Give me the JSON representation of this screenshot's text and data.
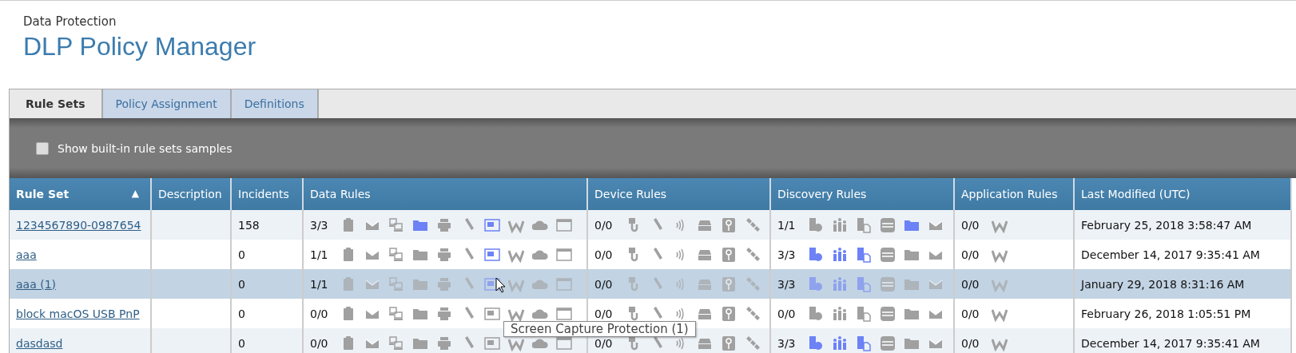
{
  "header": {
    "subtitle": "Data Protection",
    "title": "DLP Policy Manager"
  },
  "tabs": [
    {
      "label": "Rule Sets",
      "selected": true
    },
    {
      "label": "Policy Assignment",
      "selected": false
    },
    {
      "label": "Definitions",
      "selected": false
    }
  ],
  "toolbar": {
    "checkbox_label": "Show built-in rule sets samples",
    "checked": false
  },
  "table": {
    "columns": [
      {
        "label": "Rule Set",
        "sort": "▲"
      },
      {
        "label": "Description"
      },
      {
        "label": "Incidents"
      },
      {
        "label": "Data Rules"
      },
      {
        "label": "Device Rules"
      },
      {
        "label": "Discovery Rules"
      },
      {
        "label": "Application Rules"
      },
      {
        "label": "Last Modified (UTC)"
      }
    ],
    "rows": [
      {
        "name": "1234567890-0987654",
        "description": "",
        "incidents": "158",
        "selected": false,
        "data_rules": {
          "count": "3/3",
          "icons": [
            {
              "on": false
            },
            {
              "on": false
            },
            {
              "on": false
            },
            {
              "on": true
            },
            {
              "on": false
            },
            {
              "on": false
            },
            {
              "on": true
            },
            {
              "on": false
            },
            {
              "on": false
            },
            {
              "on": false
            }
          ]
        },
        "device_rules": {
          "count": "0/0",
          "icons": [
            {
              "on": false
            },
            {
              "on": false
            },
            {
              "on": false
            },
            {
              "on": false
            },
            {
              "on": false
            },
            {
              "on": false
            }
          ]
        },
        "discovery_rules": {
          "count": "1/1",
          "icons": [
            {
              "on": false
            },
            {
              "on": false
            },
            {
              "on": false
            },
            {
              "on": false
            },
            {
              "on": true
            },
            {
              "on": false
            }
          ]
        },
        "application_rules": {
          "count": "0/0",
          "icons": [
            {
              "on": false
            }
          ]
        },
        "modified": "February 25, 2018 3:58:47 AM"
      },
      {
        "name": "aaa",
        "description": "",
        "incidents": "0",
        "selected": false,
        "data_rules": {
          "count": "1/1",
          "icons": [
            {
              "on": false
            },
            {
              "on": false
            },
            {
              "on": false
            },
            {
              "on": false
            },
            {
              "on": false
            },
            {
              "on": false
            },
            {
              "on": true
            },
            {
              "on": false
            },
            {
              "on": false
            },
            {
              "on": false
            }
          ]
        },
        "device_rules": {
          "count": "0/0",
          "icons": [
            {
              "on": false
            },
            {
              "on": false
            },
            {
              "on": false
            },
            {
              "on": false
            },
            {
              "on": false
            },
            {
              "on": false
            }
          ]
        },
        "discovery_rules": {
          "count": "3/3",
          "icons": [
            {
              "on": true
            },
            {
              "on": true
            },
            {
              "on": true
            },
            {
              "on": false
            },
            {
              "on": false
            },
            {
              "on": false
            }
          ]
        },
        "application_rules": {
          "count": "0/0",
          "icons": [
            {
              "on": false
            }
          ]
        },
        "modified": "December 14, 2017 9:35:41 AM"
      },
      {
        "name": "aaa (1)",
        "description": "",
        "incidents": "0",
        "selected": true,
        "data_rules": {
          "count": "1/1",
          "icons": [
            {
              "on": false
            },
            {
              "on": false
            },
            {
              "on": false
            },
            {
              "on": false
            },
            {
              "on": false
            },
            {
              "on": false
            },
            {
              "on": true
            },
            {
              "on": false
            },
            {
              "on": false
            },
            {
              "on": false
            }
          ]
        },
        "device_rules": {
          "count": "0/0",
          "icons": [
            {
              "on": false
            },
            {
              "on": false
            },
            {
              "on": false
            },
            {
              "on": false
            },
            {
              "on": false
            },
            {
              "on": false
            }
          ]
        },
        "discovery_rules": {
          "count": "3/3",
          "icons": [
            {
              "on": true
            },
            {
              "on": true
            },
            {
              "on": true
            },
            {
              "on": false
            },
            {
              "on": false
            },
            {
              "on": false
            }
          ]
        },
        "application_rules": {
          "count": "0/0",
          "icons": [
            {
              "on": false
            }
          ]
        },
        "modified": "January 29, 2018 8:31:16 AM"
      },
      {
        "name": "block macOS USB PnP",
        "description": "",
        "incidents": "0",
        "selected": false,
        "data_rules": {
          "count": "0/0",
          "icons": [
            {
              "on": false
            },
            {
              "on": false
            },
            {
              "on": false
            },
            {
              "on": false
            },
            {
              "on": false
            },
            {
              "on": false
            },
            {
              "on": false
            },
            {
              "on": false
            },
            {
              "on": false
            },
            {
              "on": false
            }
          ]
        },
        "device_rules": {
          "count": "0/0",
          "icons": [
            {
              "on": false
            },
            {
              "on": false
            },
            {
              "on": false
            },
            {
              "on": false
            },
            {
              "on": false
            },
            {
              "on": false
            }
          ]
        },
        "discovery_rules": {
          "count": "0/0",
          "icons": [
            {
              "on": false
            },
            {
              "on": false
            },
            {
              "on": false
            },
            {
              "on": false
            },
            {
              "on": false
            },
            {
              "on": false
            }
          ]
        },
        "application_rules": {
          "count": "0/0",
          "icons": [
            {
              "on": false
            }
          ]
        },
        "modified": "February 26, 2018 1:05:51 PM"
      },
      {
        "name": "dasdasd",
        "description": "",
        "incidents": "0",
        "selected": false,
        "data_rules": {
          "count": "0/0",
          "icons": [
            {
              "on": false
            },
            {
              "on": false
            },
            {
              "on": false
            },
            {
              "on": false
            },
            {
              "on": false
            },
            {
              "on": false
            },
            {
              "on": false
            },
            {
              "on": false
            },
            {
              "on": false
            },
            {
              "on": false
            }
          ]
        },
        "device_rules": {
          "count": "0/0",
          "icons": [
            {
              "on": false
            },
            {
              "on": false
            },
            {
              "on": false
            },
            {
              "on": false
            },
            {
              "on": false
            },
            {
              "on": false
            }
          ]
        },
        "discovery_rules": {
          "count": "3/3",
          "icons": [
            {
              "on": true
            },
            {
              "on": true
            },
            {
              "on": true
            },
            {
              "on": false
            },
            {
              "on": false
            },
            {
              "on": false
            }
          ]
        },
        "application_rules": {
          "count": "0/0",
          "icons": [
            {
              "on": false
            }
          ]
        },
        "modified": "December 14, 2017 9:35:41 AM"
      }
    ]
  },
  "tooltip": {
    "text": "Screen Capture Protection (1)"
  }
}
